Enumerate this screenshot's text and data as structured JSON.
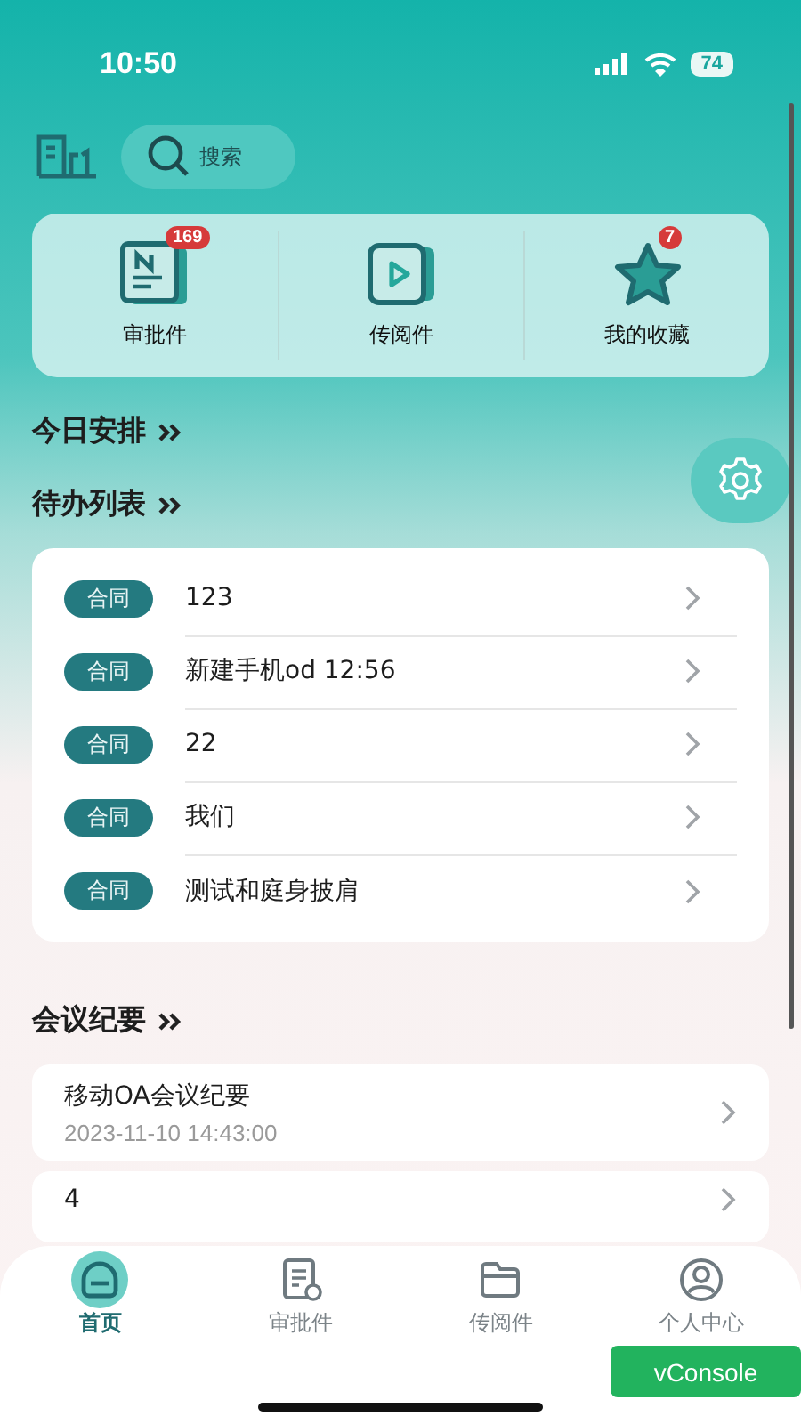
{
  "status_bar": {
    "time": "10:50",
    "battery": "74"
  },
  "search": {
    "placeholder": "搜索"
  },
  "shortcuts": [
    {
      "kind": "document",
      "label": "审批件",
      "badge": "169"
    },
    {
      "kind": "play",
      "label": "传阅件"
    },
    {
      "kind": "star",
      "label": "我的收藏",
      "badge": "7"
    }
  ],
  "schedule": {
    "heading": "今日安排"
  },
  "todo": {
    "heading": "待办列表",
    "items": [
      {
        "tag": "合同",
        "title": "123"
      },
      {
        "tag": "合同",
        "title": "新建手机od 12:56"
      },
      {
        "tag": "合同",
        "title": "22"
      },
      {
        "tag": "合同",
        "title": "我们"
      },
      {
        "tag": "合同",
        "title": "测试和庭身披肩"
      }
    ]
  },
  "meetings": {
    "heading": "会议纪要",
    "items": [
      {
        "title": "移动OA会议纪要",
        "date": "2023-11-10 14:43:00"
      },
      {
        "title": "4"
      }
    ]
  },
  "tab_bar": [
    {
      "kind": "home",
      "label": "首页",
      "selected": true
    },
    {
      "kind": "document",
      "label": "审批件",
      "selected": false
    },
    {
      "kind": "folder",
      "label": "传阅件",
      "selected": false
    },
    {
      "kind": "person",
      "label": "个人中心",
      "selected": false
    }
  ],
  "vconsole": "vConsole"
}
